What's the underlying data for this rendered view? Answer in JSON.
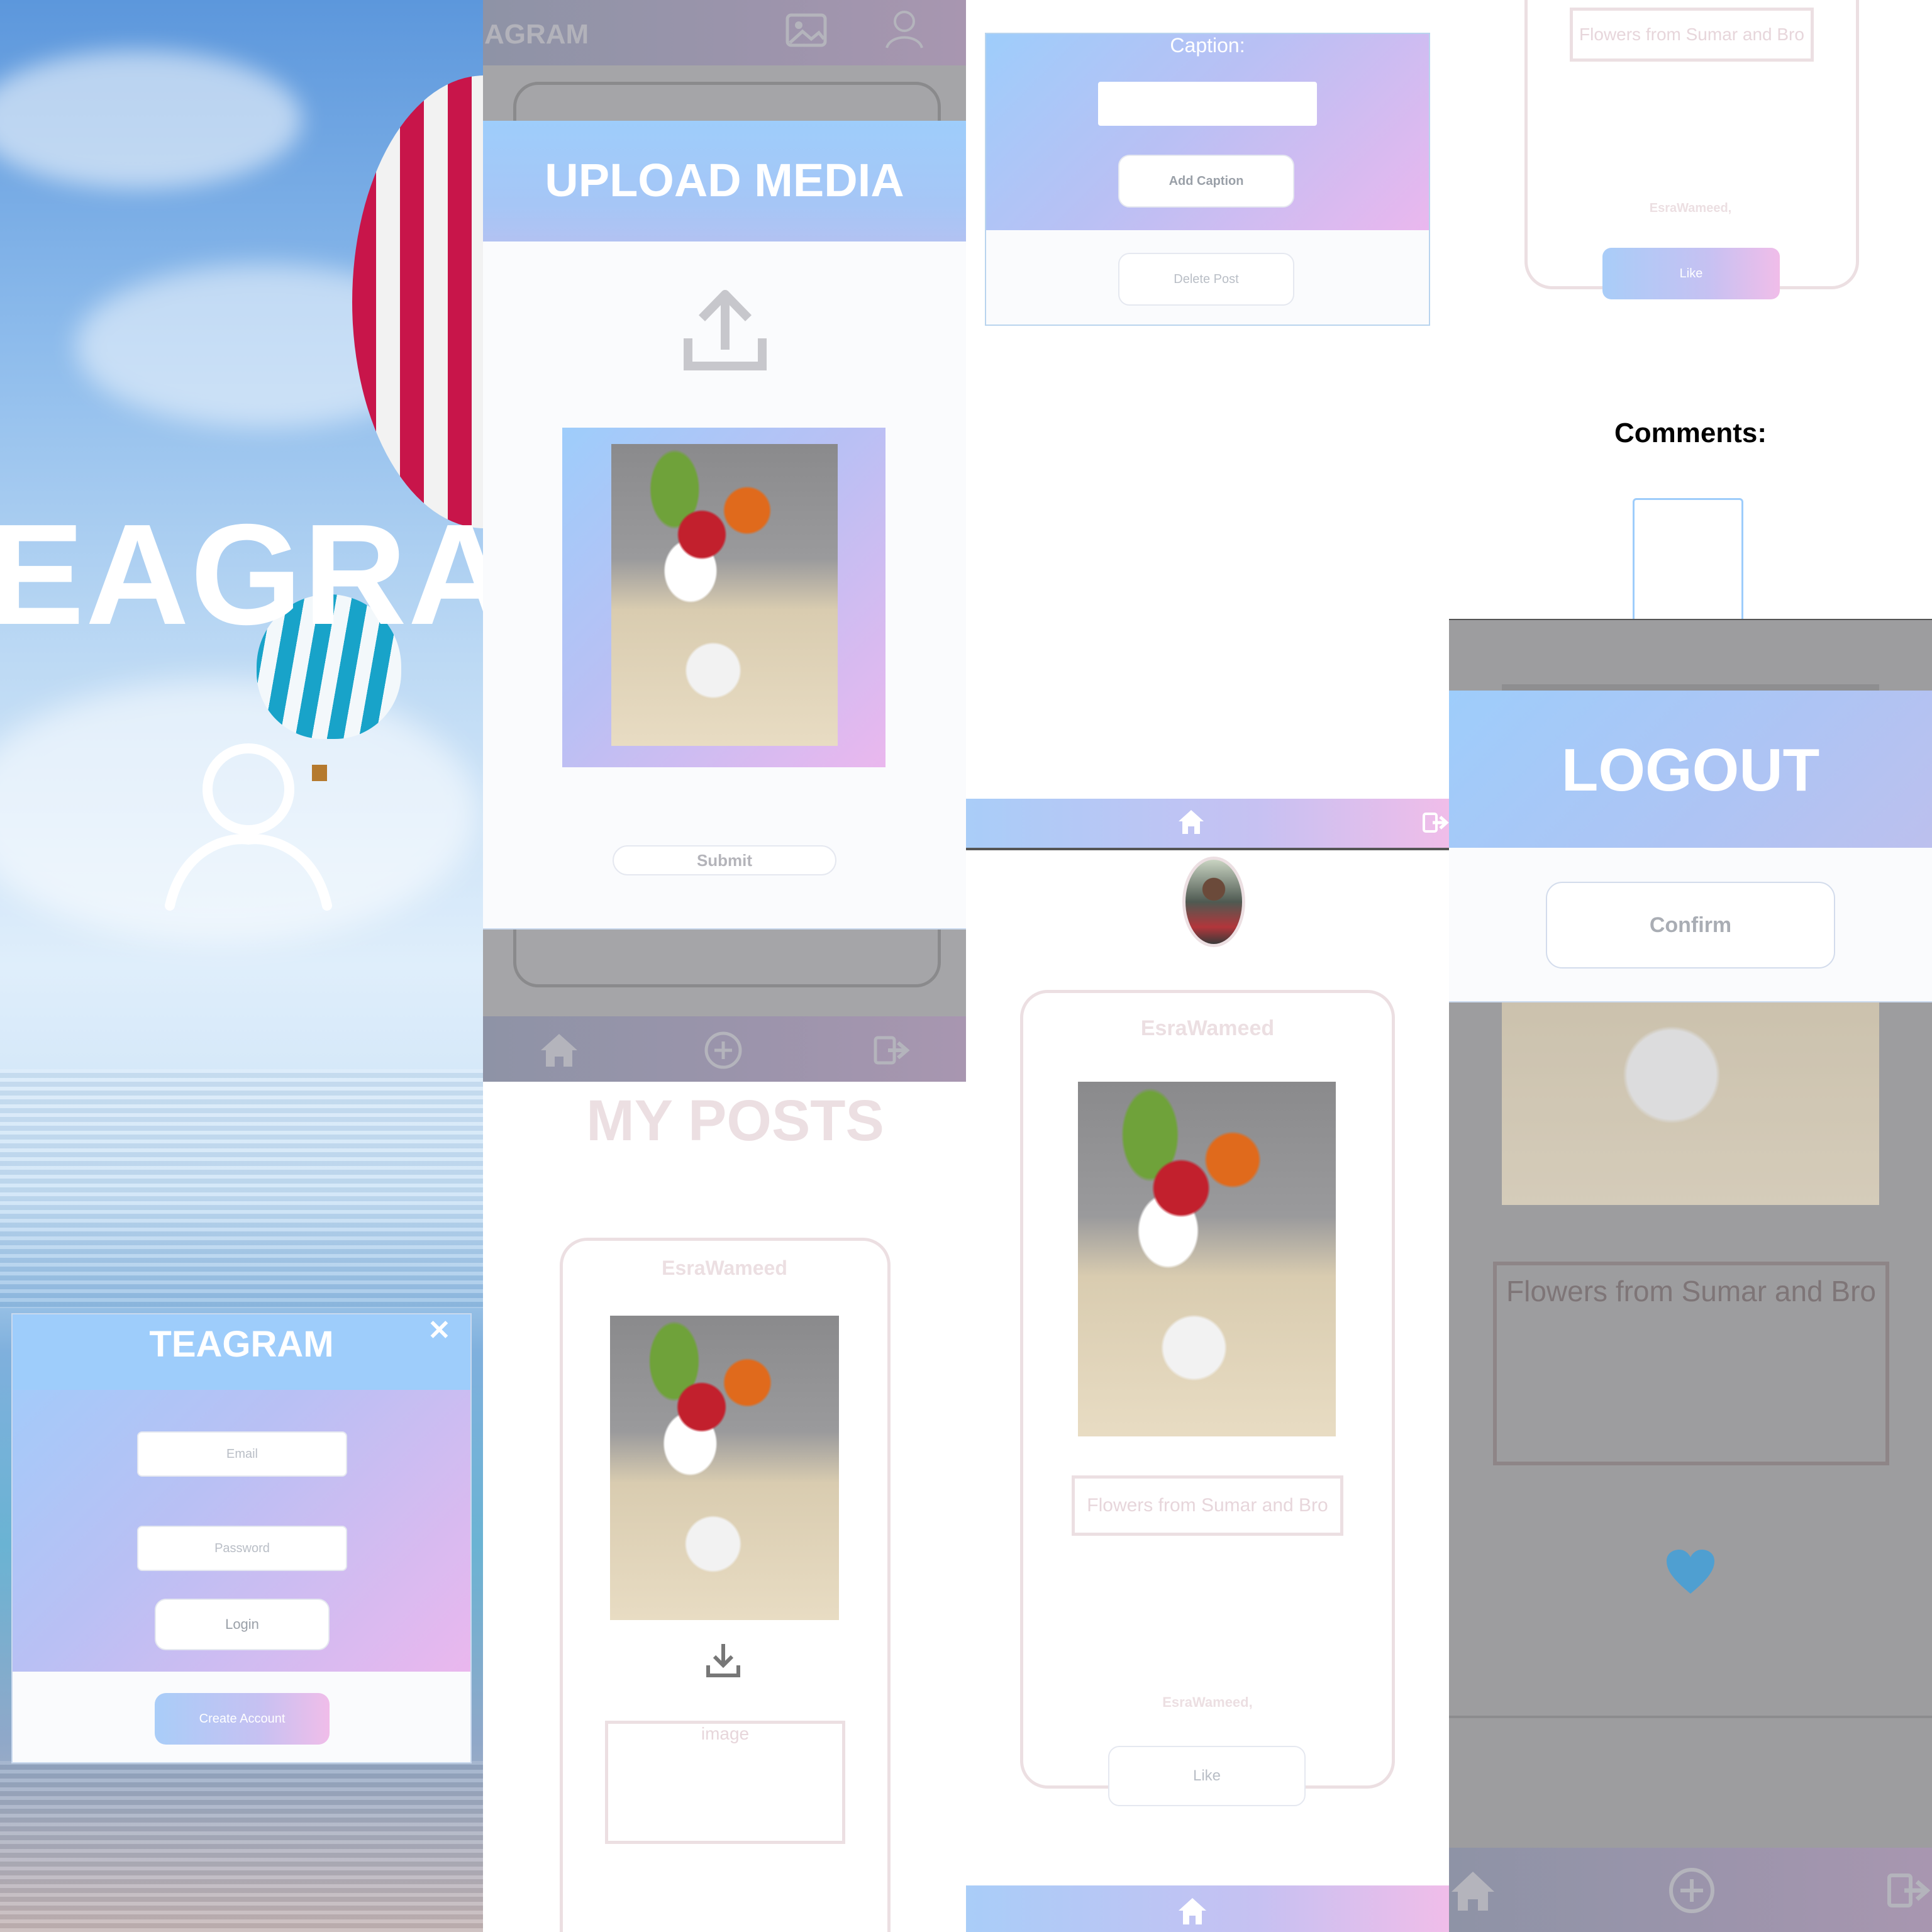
{
  "login": {
    "logo_partial": "EAGRA",
    "modal_title": "TEAGRAM",
    "close_glyph": "✕",
    "email_placeholder": "Email",
    "password_placeholder": "Password",
    "login_label": "Login",
    "create_account_label": "Create Account"
  },
  "upload": {
    "header_partial": "AGRAM",
    "modal_title": "UPLOAD MEDIA",
    "submit_label": "Submit"
  },
  "my_posts": {
    "title": "MY POSTS",
    "username": "EsraWameed",
    "caption_placeholder": "image"
  },
  "caption_edit": {
    "caption_label": "Caption:",
    "add_caption_label": "Add Caption",
    "delete_post_label": "Delete Post"
  },
  "feed": {
    "username": "EsraWameed",
    "caption": "Flowers from Sumar and Bro",
    "likes_text": "EsraWameed,",
    "like_label": "Like"
  },
  "detail": {
    "caption": "Flowers from Sumar and Bro",
    "likes_text": "EsraWameed,",
    "like_label": "Like",
    "comments_label": "Comments:",
    "logout_title": "LOGOUT",
    "confirm_label": "Confirm",
    "bg_caption": "Flowers from Sumar and Bro"
  },
  "icons": [
    "home-icon",
    "add-circle-icon",
    "logout-icon",
    "image-icon",
    "user-icon",
    "upload-icon",
    "download-icon",
    "heart-icon",
    "close-icon"
  ],
  "colors": {
    "accent_blue": "#9ecdfb",
    "accent_pink": "#eab7ee",
    "frame_pink": "#ecdfe2",
    "heart": "#4f9fd1"
  }
}
